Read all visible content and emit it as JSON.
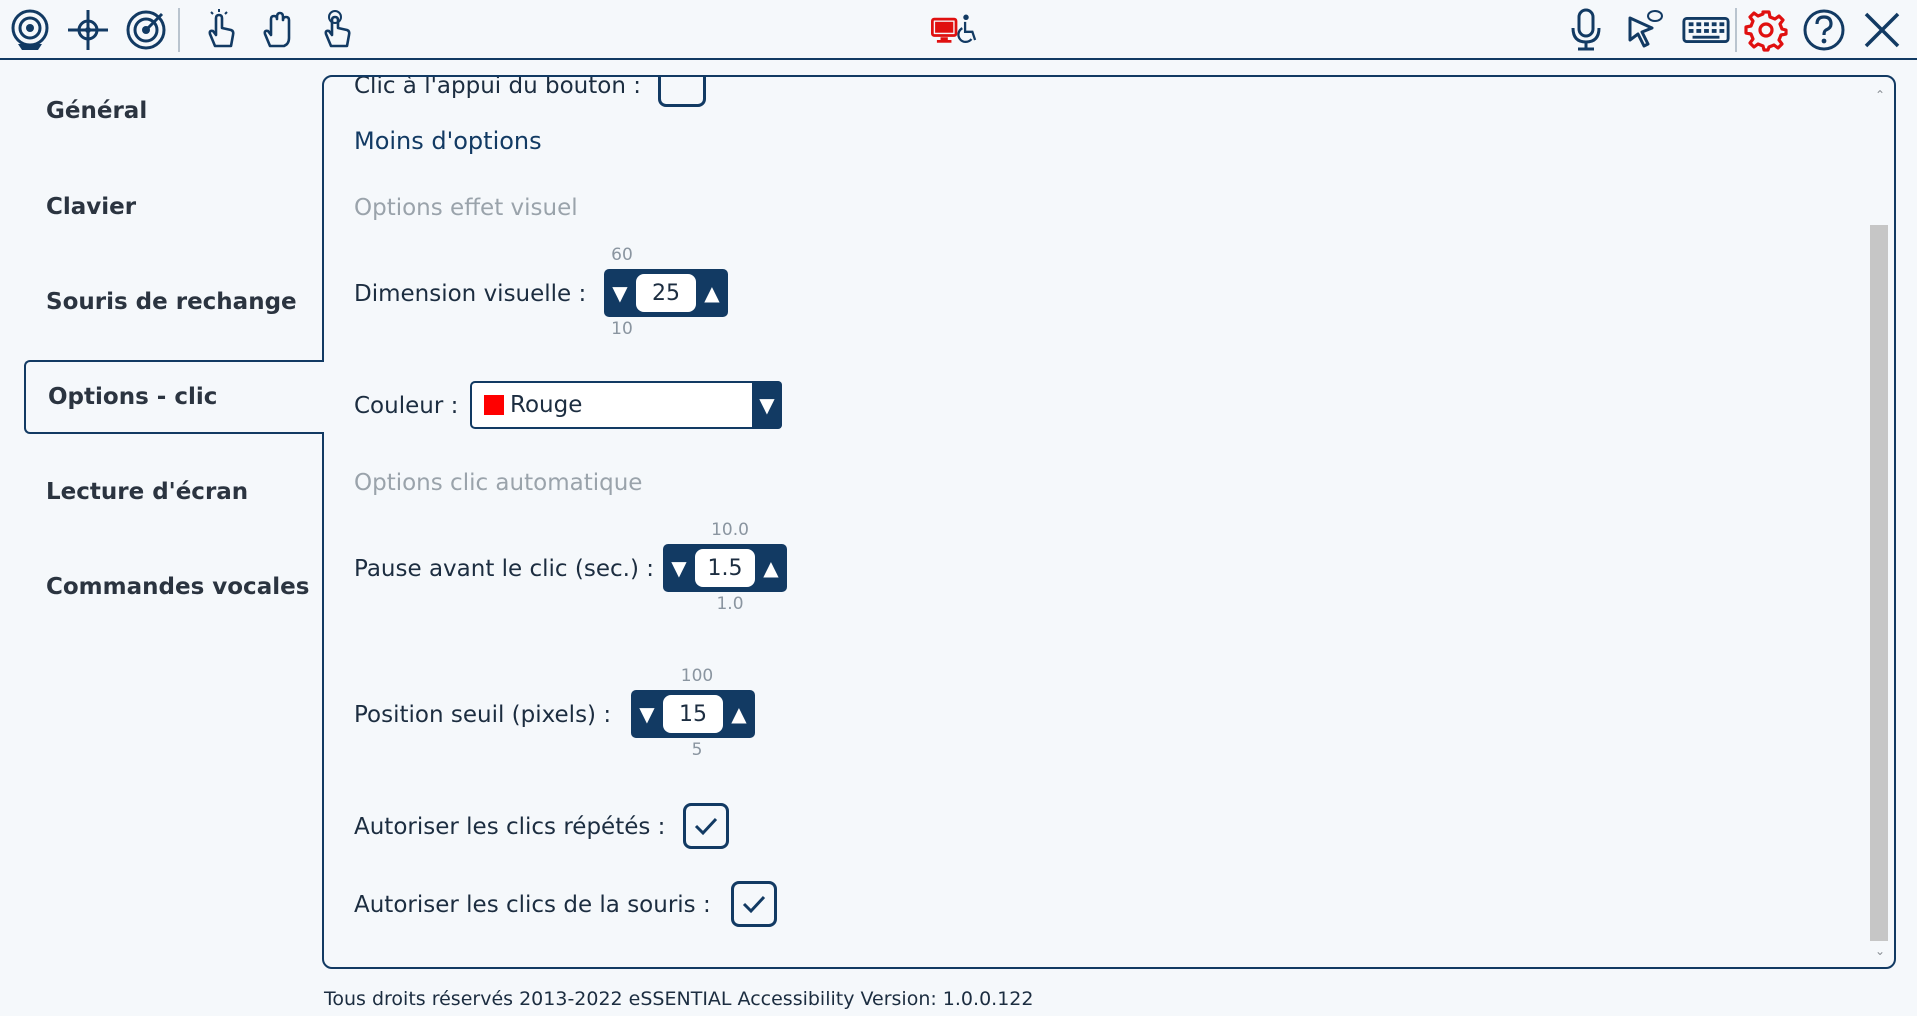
{
  "toolbar": {
    "left_icons": [
      "camera-icon",
      "crosshair-icon",
      "target-icon",
      "tap-hand-icon",
      "open-hand-icon",
      "press-hand-icon"
    ],
    "center_icon": "accessibility-monitor-icon",
    "right_icons": [
      "microphone-icon",
      "cursor-chat-icon",
      "keyboard-icon",
      "gear-icon",
      "help-icon",
      "close-icon"
    ]
  },
  "sidebar": {
    "items": [
      {
        "label": "Général"
      },
      {
        "label": "Clavier"
      },
      {
        "label": "Souris de rechange"
      },
      {
        "label": "Options - clic",
        "active": true
      },
      {
        "label": "Lecture d'écran"
      },
      {
        "label": "Commandes vocales"
      }
    ]
  },
  "content": {
    "clip_label": "Clic à l'appui du bouton :",
    "less_options": "Moins d'options",
    "visual_section": "Options effet visuel",
    "visual_dimension": {
      "label": "Dimension visuelle :",
      "value": "25",
      "max": "60",
      "min": "10"
    },
    "color": {
      "label": "Couleur :",
      "value": "Rouge",
      "swatch": "#ff0000"
    },
    "auto_section": "Options clic automatique",
    "pause": {
      "label": "Pause avant le clic (sec.) :",
      "value": "1.5",
      "max": "10.0",
      "min": "1.0"
    },
    "threshold": {
      "label": "Position seuil (pixels) :",
      "value": "15",
      "max": "100",
      "min": "5"
    },
    "repeat_clicks": {
      "label": "Autoriser les clics répétés :",
      "checked": true
    },
    "mouse_clicks": {
      "label": "Autoriser les clics de la souris :",
      "checked": true
    }
  },
  "footer": {
    "text": "Tous droits réservés 2013-2022 eSSENTIAL Accessibility Version: 1.0.0.122"
  },
  "colors": {
    "accent": "#123a63",
    "alert": "#e01010"
  }
}
